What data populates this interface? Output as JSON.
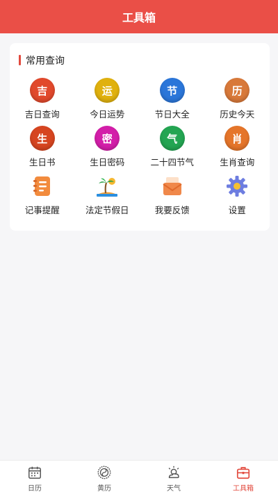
{
  "header": {
    "title": "工具箱"
  },
  "section": {
    "title": "常用查询"
  },
  "tools": [
    {
      "label": "吉日查询",
      "glyph": "吉",
      "icon": "lucky-day-icon",
      "color": "#e1492c"
    },
    {
      "label": "今日运势",
      "glyph": "运",
      "icon": "fortune-icon",
      "color": "#e0b10e"
    },
    {
      "label": "节日大全",
      "glyph": "节",
      "icon": "festival-icon",
      "color": "#2b76d9"
    },
    {
      "label": "历史今天",
      "glyph": "历",
      "icon": "history-icon",
      "color": "#d8793a"
    },
    {
      "label": "生日书",
      "glyph": "生",
      "icon": "birthday-book-icon",
      "color": "#d64520"
    },
    {
      "label": "生日密码",
      "glyph": "密",
      "icon": "birthday-code-icon",
      "color": "#d31ea9"
    },
    {
      "label": "二十四节气",
      "glyph": "气",
      "icon": "solar-terms-icon",
      "color": "#23a552"
    },
    {
      "label": "生肖查询",
      "glyph": "肖",
      "icon": "zodiac-icon",
      "color": "#e5752a"
    },
    {
      "label": "记事提醒",
      "glyph": "",
      "icon": "notepad-icon",
      "color": "#f28b3d"
    },
    {
      "label": "法定节假日",
      "glyph": "",
      "icon": "palm-beach-icon",
      "color": "#2ea24a"
    },
    {
      "label": "我要反馈",
      "glyph": "",
      "icon": "feedback-mail-icon",
      "color": "#f0884a"
    },
    {
      "label": "设置",
      "glyph": "",
      "icon": "gear-icon",
      "color": "#6d7de0"
    }
  ],
  "tabs": [
    {
      "label": "日历",
      "icon": "calendar-icon",
      "active": false
    },
    {
      "label": "黄历",
      "icon": "almanac-icon",
      "active": false
    },
    {
      "label": "天气",
      "icon": "weather-icon",
      "active": false
    },
    {
      "label": "工具箱",
      "icon": "toolbox-icon",
      "active": true
    }
  ],
  "colors": {
    "accent": "#ea4f47",
    "active_tab": "#e24a3e"
  }
}
